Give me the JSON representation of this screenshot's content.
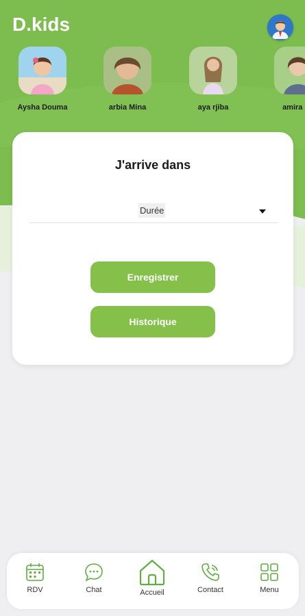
{
  "app": {
    "title": "D.kids"
  },
  "colors": {
    "brand_green": "#84c04a",
    "header_green": "#7dbd4f",
    "icon_green": "#5fae3e"
  },
  "kids": [
    {
      "name": "Aysha Douma",
      "icon": "child-photo"
    },
    {
      "name": "arbia Mina",
      "icon": "child-photo"
    },
    {
      "name": "aya rjiba",
      "icon": "child-photo"
    },
    {
      "name": "amira do",
      "icon": "child-photo"
    }
  ],
  "card": {
    "title": "J'arrive dans",
    "duration_select": "Durée",
    "save_label": "Enregistrer",
    "history_label": "Historique"
  },
  "nav": {
    "rdv": "RDV",
    "chat": "Chat",
    "home": "Accueil",
    "contact": "Contact",
    "menu": "Menu"
  }
}
